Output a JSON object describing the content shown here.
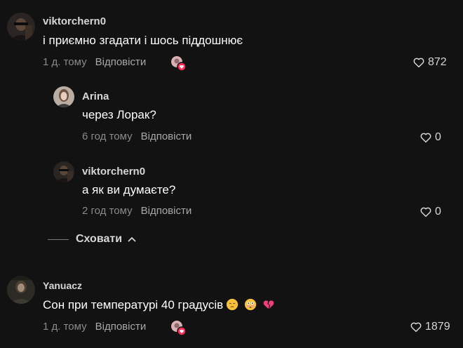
{
  "comments": [
    {
      "username": "viktorchern0",
      "text": "і приємно згадати і шось піддошнює",
      "time": "1 д. тому",
      "reply": "Відповісти",
      "likes": "872",
      "replies": [
        {
          "username": "Arina",
          "text": "через Лорак?",
          "time": "6 год тому",
          "reply": "Відповісти",
          "likes": "0"
        },
        {
          "username": "viktorchern0",
          "text": "а як ви думаєте?",
          "time": "2 год тому",
          "reply": "Відповісти",
          "likes": "0"
        }
      ],
      "hide_label": "Сховати"
    },
    {
      "username": "Yanuacz",
      "text": "Сон при температурі 40 градусів",
      "emojis": [
        "pensive-face-emoji",
        "flushed-face-emoji",
        "broken-heart-emoji"
      ],
      "time": "1 д. тому",
      "reply": "Відповісти",
      "likes": "1879"
    }
  ],
  "colors": {
    "background": "#121212",
    "username": "#d6d6d6",
    "text": "#ffffff",
    "meta": "#8a8a8a",
    "badge": "#fe2c55"
  }
}
